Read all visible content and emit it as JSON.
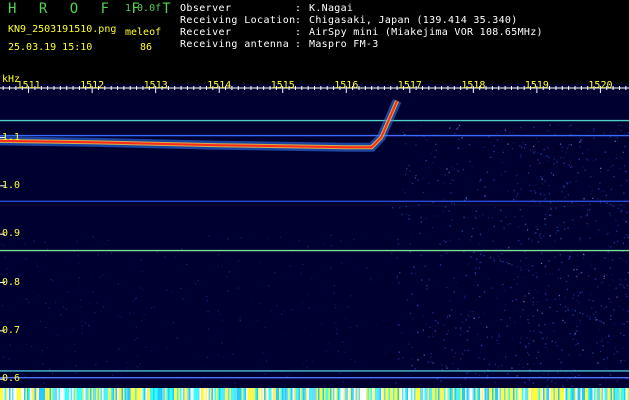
{
  "app": {
    "title": "H R O F F T",
    "version": "1.0.0f"
  },
  "file": {
    "name": "KN9_2503191510.png",
    "timestamp": "25.03.19 15:10"
  },
  "mode": {
    "label": "meleof",
    "value": "86"
  },
  "info": [
    {
      "label": "Observer",
      "value": "K.Nagai"
    },
    {
      "label": "Receiving Location",
      "value": "Chigasaki, Japan (139.414 35.340)"
    },
    {
      "label": "Receiver",
      "value": "AirSpy mini (Miakejima VOR 108.65MHz)"
    },
    {
      "label": "Receiving antenna",
      "value": "Maspro FM-3"
    }
  ],
  "separator": ":",
  "chart_data": {
    "type": "heatmap",
    "ylabel": "kHz",
    "ylim": [
      0.59,
      1.19
    ],
    "yticks": [
      "1.1",
      "1.0",
      "0.9",
      "0.8",
      "0.7",
      "0.6"
    ],
    "ytick_values": [
      1.1,
      1.0,
      0.9,
      0.8,
      0.7,
      0.6
    ],
    "x_ticks": [
      "1511",
      "1512",
      "1513",
      "1514",
      "1515",
      "1516",
      "1517",
      "1518",
      "1519",
      "1520"
    ],
    "x_tick_values": [
      1511,
      1512,
      1513,
      1514,
      1515,
      1516,
      1517,
      1518,
      1519,
      1520
    ],
    "xlim": [
      1510.55,
      1520.45
    ],
    "carriers": [
      {
        "freq": 1.135,
        "color": "#4fd0c8"
      },
      {
        "freq": 1.104,
        "color": "#3c6cff"
      },
      {
        "freq": 0.968,
        "color": "#2a4ad8"
      },
      {
        "freq": 0.866,
        "color": "#78e090"
      },
      {
        "freq": 0.617,
        "color": "#4fc0d8"
      },
      {
        "freq": 0.603,
        "color": "#5070ff"
      }
    ],
    "echo_trace": {
      "color": "#ff2a1a",
      "points": [
        [
          1510.55,
          1.093
        ],
        [
          1512.0,
          1.09
        ],
        [
          1514.0,
          1.084
        ],
        [
          1516.0,
          1.08
        ],
        [
          1516.4,
          1.08
        ],
        [
          1516.55,
          1.1
        ],
        [
          1516.8,
          1.176
        ]
      ]
    },
    "background_color": "#000030",
    "colors": {
      "label": "#ffff33",
      "title": "#52d152"
    }
  }
}
